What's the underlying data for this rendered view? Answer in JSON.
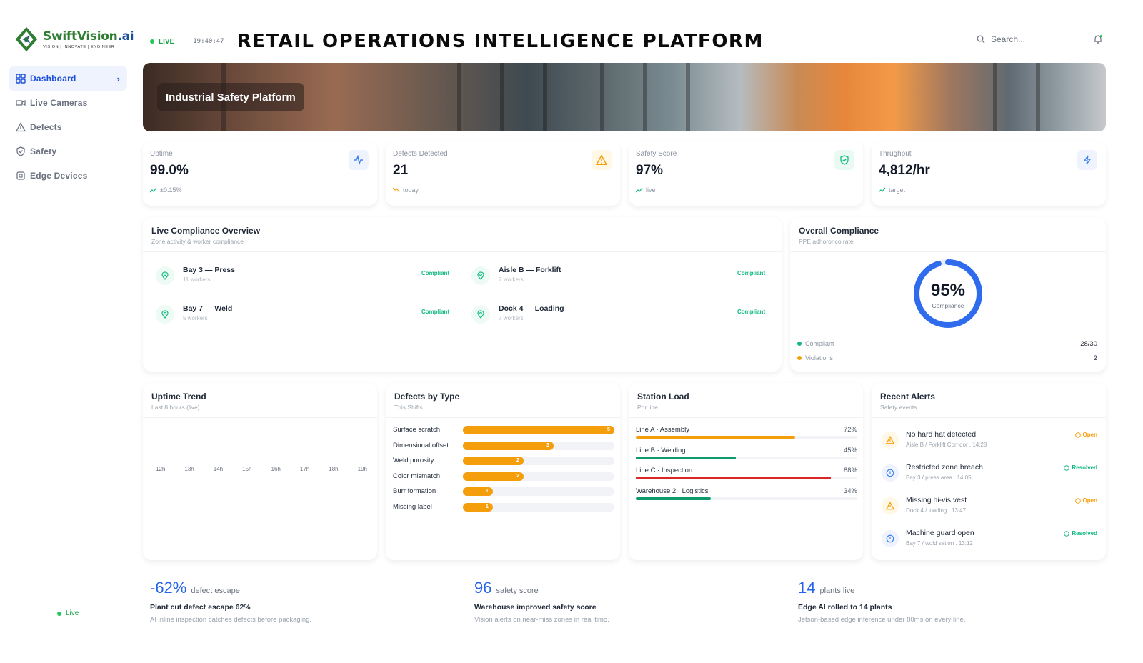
{
  "brand": {
    "name_main": "SwiftVision",
    "name_suffix": ".ai",
    "tagline": "VISION | INNOVATE | ENGINEER"
  },
  "sidebar": {
    "items": [
      {
        "label": "Dashboard",
        "icon": "grid-icon"
      },
      {
        "label": "Live Cameras",
        "icon": "camera-icon"
      },
      {
        "label": "Defects",
        "icon": "warning-icon"
      },
      {
        "label": "Safety",
        "icon": "shield-icon"
      },
      {
        "label": "Edge Devices",
        "icon": "chip-icon"
      }
    ],
    "status": "Live"
  },
  "topbar": {
    "live": "LIVE",
    "clock": "19:40:47",
    "title": "RETAIL OPERATIONS INTELLIGENCE PLATFORM",
    "search_placeholder": "Search..."
  },
  "hero": {
    "badge": "Industrial Safety Platform"
  },
  "kpis": [
    {
      "label": "Uptime",
      "value": "99.0%",
      "sub": "±0.15%",
      "icon": "activity-icon",
      "accent": "#3b82f6"
    },
    {
      "label": "Defects Detected",
      "value": "21",
      "sub": "today",
      "icon": "warning-icon",
      "accent": "#f59e0b"
    },
    {
      "label": "Safety Score",
      "value": "97%",
      "sub": "live",
      "icon": "shield-check-icon",
      "accent": "#10b981"
    },
    {
      "label": "Thrughput",
      "value": "4,812/hr",
      "sub": "target",
      "icon": "bolt-icon",
      "accent": "#3b82f6"
    }
  ],
  "compliance": {
    "title": "Live Compliance Overview",
    "subtitle": "Zone activity & worker compliance",
    "zones": [
      {
        "name": "Bay 3 — Press",
        "workers": "11 workers",
        "status": "Compliant"
      },
      {
        "name": "Aisle B — Forklift",
        "workers": "7 workers",
        "status": "Compliant"
      },
      {
        "name": "Bay 7 — Weld",
        "workers": "5 workers",
        "status": "Compliant"
      },
      {
        "name": "Dock 4 — Loading",
        "workers": "7 workers",
        "status": "Compliant"
      }
    ]
  },
  "overall": {
    "title": "Overall Compliance",
    "subtitle": "PPE adhoronco rate",
    "percent": "95%",
    "ring_fraction": 0.95,
    "ring_label": "Compliance",
    "legend": [
      {
        "label": "Compliant",
        "value": "28/30",
        "color": "#10b981"
      },
      {
        "label": "Violations",
        "value": "2",
        "color": "#f59e0b"
      }
    ]
  },
  "uptime": {
    "title": "Uptime Trend",
    "subtitle": "Last 8 hours (live)",
    "ticks": [
      "12h",
      "13h",
      "14h",
      "15h",
      "16h",
      "17h",
      "18h",
      "19h"
    ]
  },
  "defects": {
    "title": "Defects by Type",
    "subtitle": "This Shifts",
    "max": 5,
    "items": [
      {
        "label": "Surface scratch",
        "value": 5,
        "text": "5"
      },
      {
        "label": "Dimensional offset",
        "value": 3,
        "text": "3"
      },
      {
        "label": "Weld porosity",
        "value": 2,
        "text": "2"
      },
      {
        "label": "Color mismatch",
        "value": 2,
        "text": "2"
      },
      {
        "label": "Burr formation",
        "value": 1,
        "text": "1"
      },
      {
        "label": "Missing label",
        "value": 1,
        "text": "1"
      }
    ]
  },
  "station": {
    "title": "Station Load",
    "subtitle": "Por line",
    "items": [
      {
        "label": "Line A · Assembly",
        "value": 0.72,
        "text": "72%",
        "color": "#f59e0b"
      },
      {
        "label": "Line B · Welding",
        "value": 0.45,
        "text": "45%",
        "color": "#0f9a6e"
      },
      {
        "label": "Line C · Inspection",
        "value": 0.88,
        "text": "88%",
        "color": "#dc2626"
      },
      {
        "label": "Warehouse 2 · Logistics",
        "value": 0.34,
        "text": "34%",
        "color": "#0f9a6e"
      }
    ]
  },
  "alerts": {
    "title": "Recent Alerts",
    "subtitle": "Safety events",
    "items": [
      {
        "title": "No hard hat detected",
        "meta": "Aisle B / Forklift Corridor . 14:28",
        "status": "Open",
        "kind": "warning"
      },
      {
        "title": "Restricted zone breach",
        "meta": "Bay 3 / press area . 14:05",
        "status": "Resolved",
        "kind": "info"
      },
      {
        "title": "Missing hi-vis vest",
        "meta": "Dock 4 / loading . 13:47",
        "status": "Open",
        "kind": "warning"
      },
      {
        "title": "Machine guard open",
        "meta": "Bay 7 / wold sation . 13:12",
        "status": "Resolved",
        "kind": "info"
      }
    ]
  },
  "stats": [
    {
      "big": "-62%",
      "unit": "defect escape",
      "headline": "Plant cut defect escape 62%",
      "desc": "AI inline inspection catches defects before packaging."
    },
    {
      "big": "96",
      "unit": "safety score",
      "headline": "Warehouse improved safety score",
      "desc": "Vision alerts on near-miss zones in real timo."
    },
    {
      "big": "14",
      "unit": "plants live",
      "headline": "Edge AI rolled to 14 plants",
      "desc": "Jetson-based edge inference under 80ms on every line."
    }
  ]
}
